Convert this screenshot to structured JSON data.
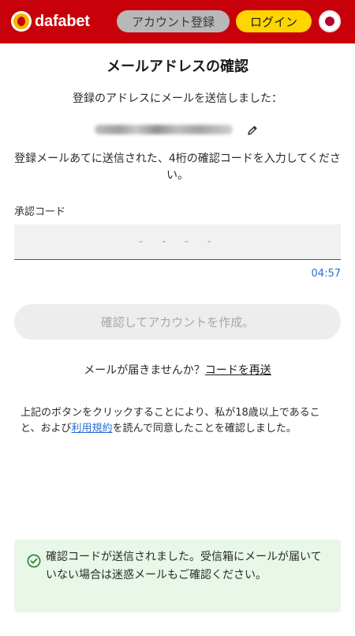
{
  "header": {
    "logo_text": "dafabet",
    "register_label": "アカウント登録",
    "login_label": "ログイン",
    "language_icon": "japan-flag-icon",
    "colors": {
      "bar": "#c8000a",
      "login": "#ffd500",
      "register": "#b8b8b8"
    }
  },
  "main": {
    "title": "メールアドレスの確認",
    "sent_to": "登録のアドレスにメールを送信しました：",
    "instruction": "登録メールあてに送信された、4桁の確認コードを入力してください。",
    "code_label": "承認コード",
    "code_placeholder": "- - - -",
    "code_value": "",
    "timer": "04:57",
    "confirm_label": "確認してアカウントを作成。",
    "resend_prompt": "メールが届きませんか？",
    "resend_link": "コードを再送",
    "terms_before": "上記のボタンをクリックすることにより、私が18歳以上であること、および",
    "terms_link": "利用規約",
    "terms_after": "を読んで同意したことを確認しました。"
  },
  "toast": {
    "icon": "check-circle-icon",
    "message": "確認コードが送信されました。受信箱にメールが届いていない場合は迷惑メールもご確認ください。",
    "color": "#e8f7e8"
  }
}
